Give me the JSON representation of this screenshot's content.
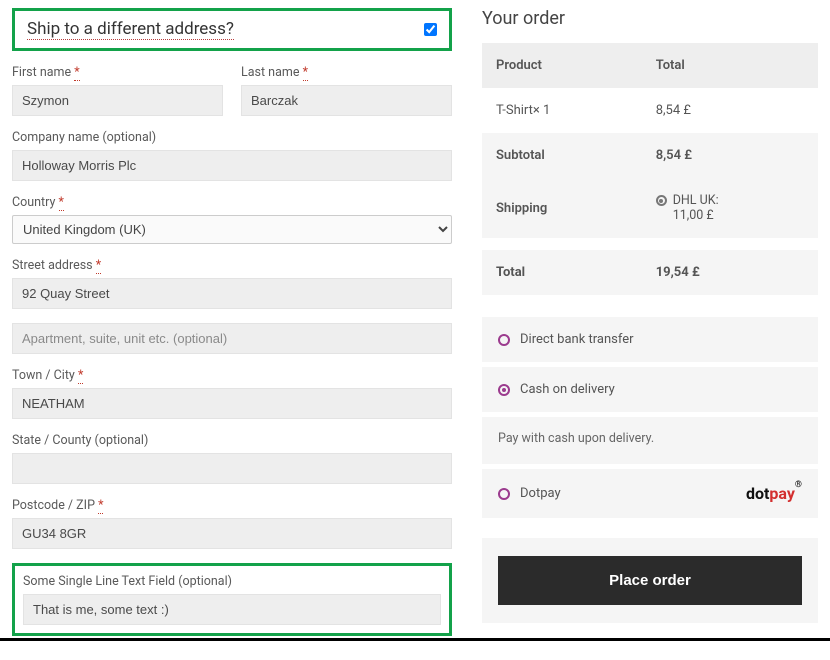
{
  "shipping": {
    "heading": "Ship to a different address?",
    "checked": true,
    "fields": {
      "first_name": {
        "label": "First name",
        "value": "Szymon",
        "required": true
      },
      "last_name": {
        "label": "Last name",
        "value": "Barczak",
        "required": true
      },
      "company": {
        "label": "Company name (optional)",
        "value": "Holloway Morris Plc",
        "required": false
      },
      "country": {
        "label": "Country",
        "value": "United Kingdom (UK)",
        "required": true
      },
      "street1": {
        "label": "Street address",
        "value": "92 Quay Street",
        "required": true
      },
      "street2": {
        "placeholder": "Apartment, suite, unit etc. (optional)",
        "value": ""
      },
      "city": {
        "label": "Town / City",
        "value": "NEATHAM",
        "required": true
      },
      "state": {
        "label": "State / County (optional)",
        "value": "",
        "required": false
      },
      "postcode": {
        "label": "Postcode / ZIP",
        "value": "GU34 8GR",
        "required": true
      },
      "custom": {
        "label": "Some Single Line Text Field (optional)",
        "value": "That is me, some text :)",
        "required": false
      }
    }
  },
  "order": {
    "heading": "Your order",
    "cols": {
      "product": "Product",
      "total": "Total"
    },
    "items": [
      {
        "name": "T-Shirt× 1",
        "total": "8,54 £"
      }
    ],
    "subtotal": {
      "label": "Subtotal",
      "value": "8,54 £"
    },
    "shipping": {
      "label": "Shipping",
      "option": "DHL UK:",
      "price": "11,00 £"
    },
    "total": {
      "label": "Total",
      "value": "19,54 £"
    }
  },
  "payments": {
    "options": [
      {
        "id": "bacs",
        "label": "Direct bank transfer",
        "selected": false
      },
      {
        "id": "cod",
        "label": "Cash on delivery",
        "selected": true,
        "desc": "Pay with cash upon delivery."
      },
      {
        "id": "dotpay",
        "label": "Dotpay",
        "selected": false,
        "logo": true
      }
    ]
  },
  "actions": {
    "place_order": "Place order"
  }
}
